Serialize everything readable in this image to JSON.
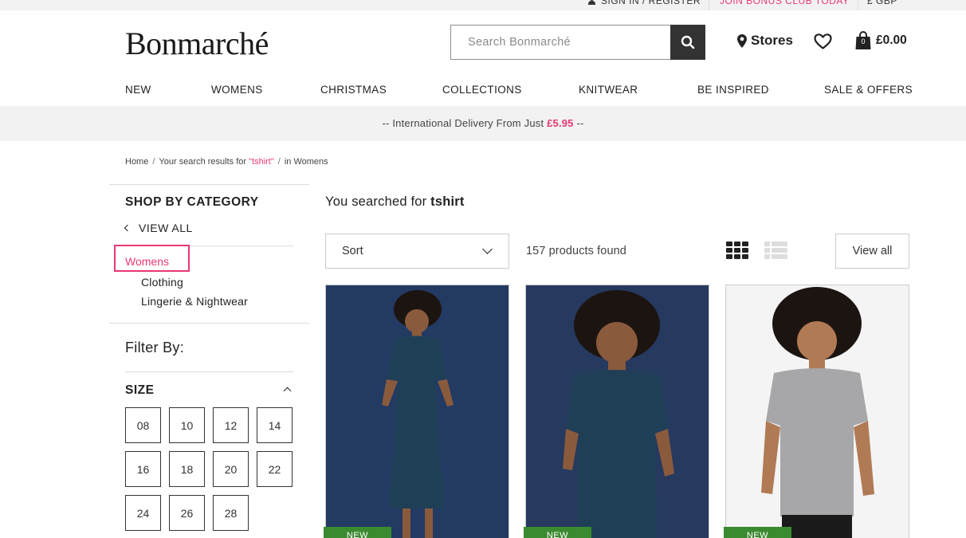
{
  "topbar": {
    "sign_in": "SIGN IN / REGISTER",
    "join": "JOIN BONUS CLUB TODAY",
    "currency": "£ GBP"
  },
  "header": {
    "logo": "Bonmarché",
    "search_placeholder": "Search Bonmarché",
    "stores": "Stores",
    "basket_count": "0",
    "basket_total": "£0.00"
  },
  "nav": [
    "NEW",
    "WOMENS",
    "CHRISTMAS",
    "COLLECTIONS",
    "KNITWEAR",
    "BE INSPIRED",
    "SALE & OFFERS"
  ],
  "promo": {
    "prefix": "-- International Delivery From Just ",
    "price": "£5.95",
    "suffix": " --"
  },
  "breadcrumb": {
    "home": "Home",
    "sep": "/",
    "search_prefix": "Your search results for ",
    "query": "\"tshirt\"",
    "context": "in Womens"
  },
  "sidebar": {
    "shop_by_category": "SHOP BY CATEGORY",
    "view_all": "VIEW ALL",
    "current_category": "Womens",
    "subcategories": [
      "Clothing",
      "Lingerie & Nightwear"
    ],
    "filter_by": "Filter By:",
    "size_title": "SIZE",
    "sizes": [
      "08",
      "10",
      "12",
      "14",
      "16",
      "18",
      "20",
      "22",
      "24",
      "26",
      "28"
    ]
  },
  "results": {
    "searched_prefix": "You searched for ",
    "query": "tshirt",
    "sort_label": "Sort",
    "count": "157 products found",
    "view_all": "View all",
    "badge": "NEW"
  },
  "colors": {
    "accent_pink": "#e8386f",
    "badge_green": "#3a8a2f",
    "dark": "#333333"
  }
}
